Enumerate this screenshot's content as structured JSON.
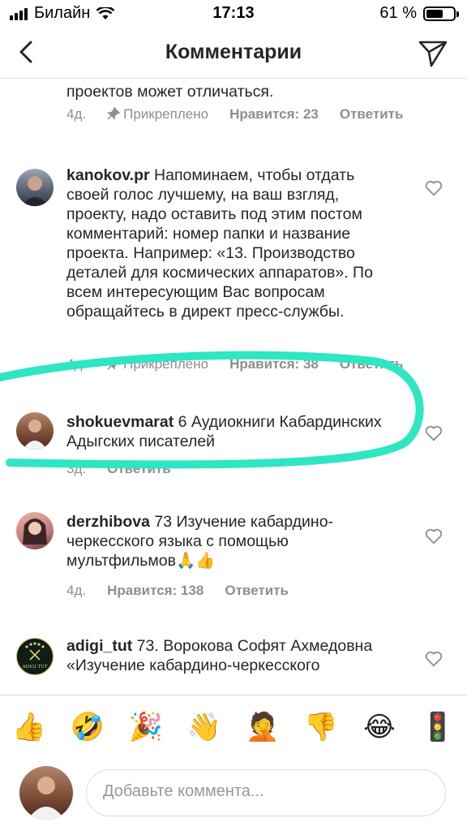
{
  "status_bar": {
    "carrier": "Билайн",
    "time": "17:13",
    "battery": "61 %",
    "battery_level": 0.61
  },
  "header": {
    "title": "Комментарии"
  },
  "comments": [
    {
      "username": "",
      "text": "проектов может отличаться.",
      "time": "4д.",
      "pinned": "Прикреплено",
      "likes": "Нравится: 23",
      "reply": "Ответить"
    },
    {
      "username": "kanokov.pr",
      "text": "Напоминаем, чтобы отдать своей голос лучшему, на ваш взгляд, проекту, надо оставить под этим постом комментарий: номер папки и название проекта. Например: «13. Производство деталей для космических аппаратов». По всем интересующим Вас вопросам обращайтесь в директ пресс-службы.",
      "time": "4д.",
      "pinned": "Прикреплено",
      "likes": "Нравится: 38",
      "reply": "Ответить"
    },
    {
      "username": "shokuevmarat",
      "text": "6 Аудиокниги Кабардинских Адыгских писателей",
      "time": "3д.",
      "reply": "Ответить"
    },
    {
      "username": "derzhibova",
      "text": "73 Изучение кабардино-черкесского языка с помощью мультфильмов🙏👍",
      "time": "4д.",
      "likes": "Нравится: 138",
      "reply": "Ответить"
    },
    {
      "username": "adigi_tut",
      "text": "73. Ворокова Софят Ахмедовна «Изучение кабардино-черкесского",
      "avatar_text": "ADIGI TUT"
    }
  ],
  "emoji_bar": [
    "👍",
    "🤣",
    "🎉",
    "👋",
    "🤦",
    "👎",
    "😂",
    "🚦"
  ],
  "input": {
    "placeholder": "Добавьте коммента..."
  },
  "colors": {
    "highlight": "#2ee6c1",
    "muted": "#8e8e8e",
    "text": "#262626",
    "border": "#dbdbdb"
  }
}
